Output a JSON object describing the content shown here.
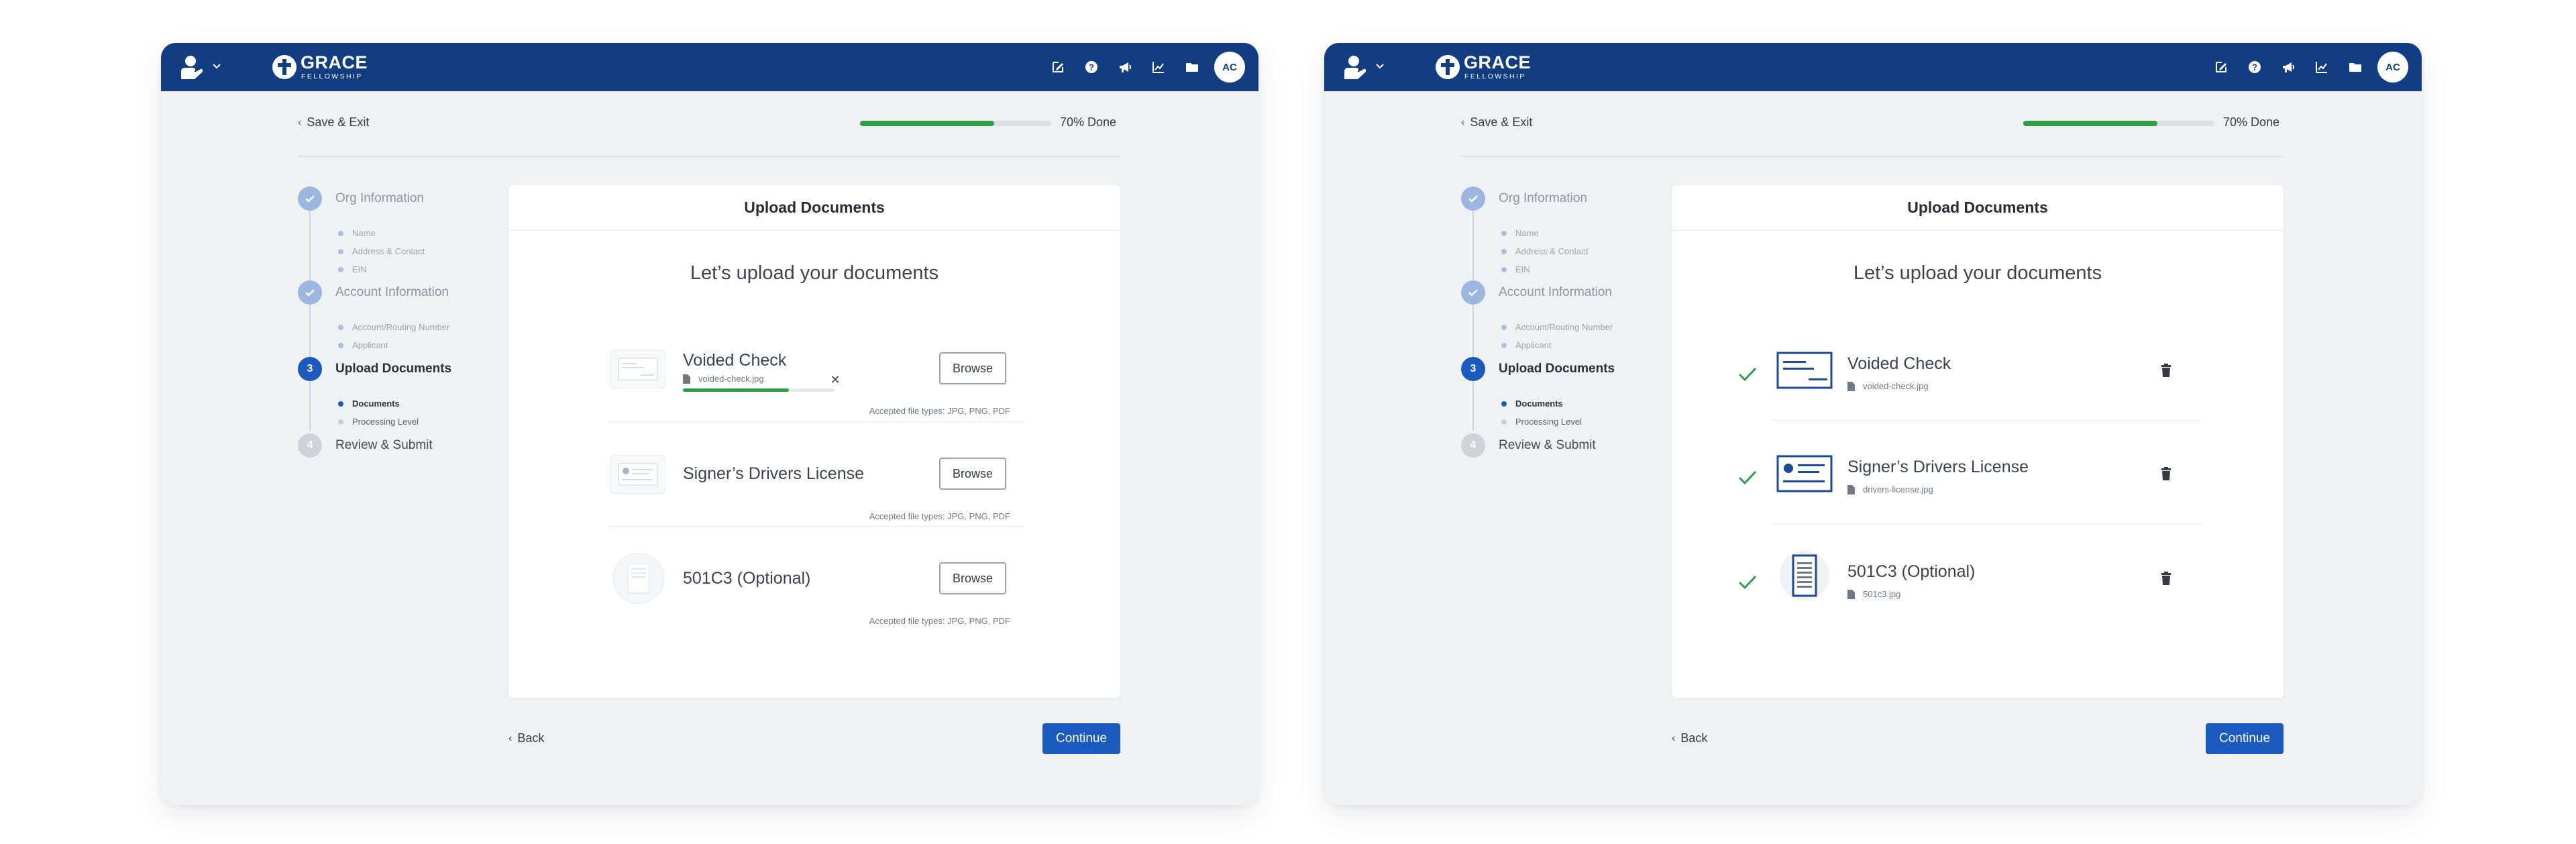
{
  "colors": {
    "brand": "#123d82",
    "accent": "#1b5bbf",
    "success": "#2f9e47"
  },
  "header": {
    "logo_name": "GRACE",
    "logo_sub": "FELLOWSHIP",
    "avatar_initials": "AC",
    "icons": [
      "edit-icon",
      "help-icon",
      "megaphone-icon",
      "chart-icon",
      "folder-icon"
    ]
  },
  "save_exit": "Save & Exit",
  "progress": {
    "label": "70% Done",
    "percent": 70
  },
  "steps": [
    {
      "number": "1",
      "label": "Org Information",
      "status": "done",
      "subs": [
        "Name",
        "Address & Contact",
        "EIN"
      ]
    },
    {
      "number": "2",
      "label": "Account Information",
      "status": "done",
      "subs": [
        "Account/Routing Number",
        "Applicant"
      ]
    },
    {
      "number": "3",
      "label": "Upload Documents",
      "status": "active",
      "subs": [
        "Documents",
        "Processing Level"
      ]
    },
    {
      "number": "4",
      "label": "Review & Submit",
      "status": "todo",
      "subs": []
    }
  ],
  "card": {
    "title": "Upload Documents",
    "intro": "Let’s upload your documents"
  },
  "uploading": {
    "documents": [
      {
        "title": "Voided Check",
        "file": "voided-check.jpg",
        "upload_percent": 70,
        "browse": "Browse",
        "accepted": "Accepted file types: JPG, PNG, PDF"
      },
      {
        "title": "Signer’s Drivers License",
        "browse": "Browse",
        "accepted": "Accepted file types: JPG, PNG, PDF"
      },
      {
        "title": "501C3 (Optional)",
        "browse": "Browse",
        "accepted": "Accepted file types: JPG, PNG, PDF"
      }
    ]
  },
  "uploaded": {
    "documents": [
      {
        "title": "Voided Check",
        "file": "voided-check.jpg"
      },
      {
        "title": "Signer’s Drivers License",
        "file": "drivers-license.jpg"
      },
      {
        "title": "501C3 (Optional)",
        "file": "501c3.jpg"
      }
    ]
  },
  "nav": {
    "back": "Back",
    "continue": "Continue"
  }
}
